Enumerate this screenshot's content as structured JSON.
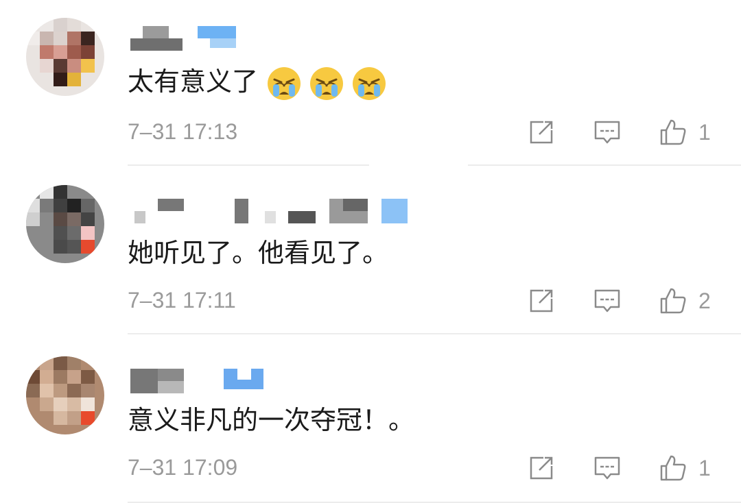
{
  "comments": [
    {
      "text": "太有意义了",
      "emoji_icons": [
        "loudly-crying-face-icon",
        "loudly-crying-face-icon",
        "loudly-crying-face-icon"
      ],
      "time": "7–31 17:13",
      "likes": "1"
    },
    {
      "text": "她听见了。他看见了。",
      "time": "7–31 17:11",
      "likes": "2"
    },
    {
      "text": "意义非凡的一次夺冠！。",
      "time": "7–31 17:09",
      "likes": "1"
    }
  ],
  "icons": {
    "share": "share-icon",
    "reply": "comment-icon",
    "like": "thumbs-up-icon"
  },
  "colors": {
    "text": "#1a1a1a",
    "meta": "#9a9a9a",
    "divider": "#ececec",
    "verified_badge": "#4a9ef0"
  }
}
